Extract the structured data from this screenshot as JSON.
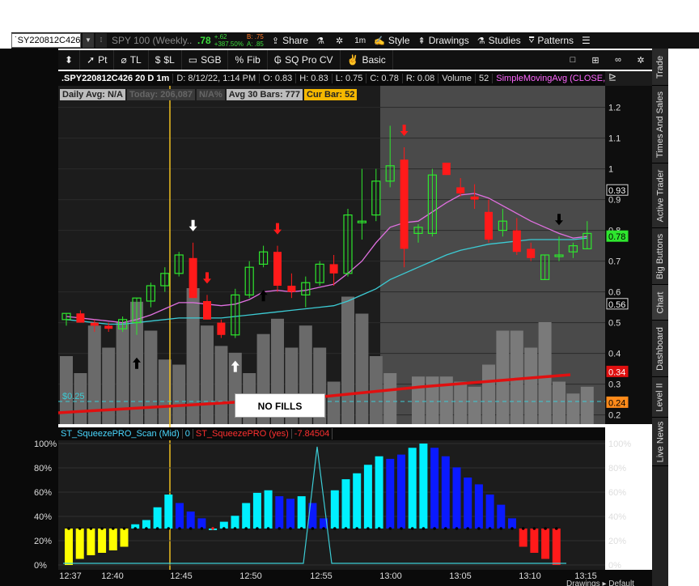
{
  "topbar": {
    "symbol": "˙SY220812C426",
    "underlying": "SPY 100 (Weekly...",
    "last": ".78",
    "change_abs": "+.62",
    "change_pct": "+387.50%",
    "bid": "B: .75",
    "ask": "A: .85",
    "share": "Share",
    "timeframe": "1m",
    "style": "Style",
    "drawings": "Drawings",
    "studies": "Studies",
    "patterns": "Patterns"
  },
  "toolbar2": {
    "pt": "Pt",
    "tl": "TL",
    "sl": "$L",
    "sgb": "SGB",
    "fib": "Fib",
    "sqpro": "SQ Pro CV",
    "basic": "Basic"
  },
  "chart_info": {
    "symbol": ".SPY220812C426 20 D 1m",
    "date": "D: 8/12/22, 1:14 PM",
    "open": "O: 0.83",
    "high": "H: 0.83",
    "low": "L: 0.75",
    "close": "C: 0.78",
    "range": "R: 0.08",
    "volume_label": "Volume",
    "volume": "52",
    "sma": "SimpleMovingAvg (CLOSE, 8,..."
  },
  "badges": {
    "daily_avg": "Daily Avg: N/A",
    "today": "Today: 206,087",
    "na_pct": "N/A%",
    "avg30": "Avg 30 Bars: 777",
    "cur_bar": "Cur Bar: 52"
  },
  "no_fills": "NO FILLS",
  "price_line_label": "$0.25",
  "study_header": {
    "name": "ST_SqueezePRO_Scan (Mid)",
    "value": "0",
    "name2": "ST_SqueezePRO (yes)",
    "value2": "-7.84504"
  },
  "side_tabs": [
    "Trade",
    "Times And Sales",
    "Active Trader",
    "Big Buttons",
    "Chart",
    "Dashboard",
    "Level II",
    "Live News"
  ],
  "active_side_tab": "Chart",
  "bottom_right": "Drawings  ▸  Default",
  "colors": {
    "up": "#2ee62e",
    "down": "#ff1a1a",
    "sma_fast": "#e070e0",
    "sma_slow": "#3ccbd4",
    "cyan_bar": "#00f0ff",
    "blue_bar": "#0a1aff",
    "yellow_bar": "#ffff00",
    "red_bar": "#ff1a1a",
    "volume": "#6a6a6a",
    "trend_line": "#e01010",
    "vline": "#f0c020"
  },
  "chart_data": [
    {
      "type": "candlestick",
      "x_ticks": [
        "12:37",
        "12:40",
        "12:45",
        "12:50",
        "12:55",
        "13:00",
        "13:05",
        "13:10",
        "13:15"
      ],
      "y_ticks": [
        "0.2",
        "0.3",
        "0.4",
        "0.5",
        "0.6",
        "0.7",
        "0.8",
        "0.9",
        "1",
        "1.1",
        "1.2"
      ],
      "ylim": [
        0.17,
        1.27
      ],
      "price_labels": [
        {
          "text": "0.93",
          "value": 0.93,
          "style": "box"
        },
        {
          "text": "0.78",
          "value": 0.78,
          "style": "green"
        },
        {
          "text": "0.56",
          "value": 0.56,
          "style": "box"
        },
        {
          "text": "0.34",
          "value": 0.34,
          "style": "red"
        },
        {
          "text": "0.24",
          "value": 0.24,
          "style": "orange"
        }
      ],
      "candles": [
        {
          "o": 0.51,
          "h": 0.53,
          "l": 0.49,
          "c": 0.53
        },
        {
          "o": 0.53,
          "h": 0.54,
          "l": 0.5,
          "c": 0.5
        },
        {
          "o": 0.5,
          "h": 0.51,
          "l": 0.47,
          "c": 0.49
        },
        {
          "o": 0.49,
          "h": 0.5,
          "l": 0.47,
          "c": 0.48
        },
        {
          "o": 0.48,
          "h": 0.52,
          "l": 0.47,
          "c": 0.51
        },
        {
          "o": 0.5,
          "h": 0.58,
          "l": 0.46,
          "c": 0.58
        },
        {
          "o": 0.57,
          "h": 0.63,
          "l": 0.55,
          "c": 0.62
        },
        {
          "o": 0.62,
          "h": 0.68,
          "l": 0.6,
          "c": 0.66
        },
        {
          "o": 0.66,
          "h": 0.73,
          "l": 0.65,
          "c": 0.72
        },
        {
          "o": 0.71,
          "h": 0.76,
          "l": 0.58,
          "c": 0.58
        },
        {
          "o": 0.57,
          "h": 0.59,
          "l": 0.51,
          "c": 0.51
        },
        {
          "o": 0.5,
          "h": 0.51,
          "l": 0.45,
          "c": 0.46
        },
        {
          "o": 0.46,
          "h": 0.61,
          "l": 0.45,
          "c": 0.59
        },
        {
          "o": 0.59,
          "h": 0.7,
          "l": 0.58,
          "c": 0.68
        },
        {
          "o": 0.69,
          "h": 0.75,
          "l": 0.68,
          "c": 0.73
        },
        {
          "o": 0.73,
          "h": 0.75,
          "l": 0.6,
          "c": 0.62
        },
        {
          "o": 0.62,
          "h": 0.66,
          "l": 0.58,
          "c": 0.6
        },
        {
          "o": 0.59,
          "h": 0.65,
          "l": 0.55,
          "c": 0.63
        },
        {
          "o": 0.63,
          "h": 0.7,
          "l": 0.62,
          "c": 0.69
        },
        {
          "o": 0.69,
          "h": 0.72,
          "l": 0.62,
          "c": 0.66
        },
        {
          "o": 0.66,
          "h": 0.87,
          "l": 0.65,
          "c": 0.85
        },
        {
          "o": 0.83,
          "h": 1.0,
          "l": 0.77,
          "c": 0.83
        },
        {
          "o": 0.85,
          "h": 1.0,
          "l": 0.83,
          "c": 0.96
        },
        {
          "o": 0.96,
          "h": 1.14,
          "l": 0.94,
          "c": 1.01
        },
        {
          "o": 1.03,
          "h": 1.07,
          "l": 0.68,
          "c": 0.74
        },
        {
          "o": 0.79,
          "h": 0.82,
          "l": 0.76,
          "c": 0.81
        },
        {
          "o": 0.79,
          "h": 1.0,
          "l": 0.78,
          "c": 0.98
        },
        {
          "o": 1.02,
          "h": 1.02,
          "l": 0.98,
          "c": 0.98
        },
        {
          "o": 0.94,
          "h": 0.97,
          "l": 0.91,
          "c": 0.92
        },
        {
          "o": 0.91,
          "h": 0.95,
          "l": 0.87,
          "c": 0.9
        },
        {
          "o": 0.86,
          "h": 0.9,
          "l": 0.76,
          "c": 0.77
        },
        {
          "o": 0.8,
          "h": 0.87,
          "l": 0.78,
          "c": 0.83
        },
        {
          "o": 0.8,
          "h": 0.84,
          "l": 0.72,
          "c": 0.73
        },
        {
          "o": 0.74,
          "h": 0.76,
          "l": 0.7,
          "c": 0.71
        },
        {
          "o": 0.64,
          "h": 0.72,
          "l": 0.64,
          "c": 0.72
        },
        {
          "o": 0.72,
          "h": 0.78,
          "l": 0.7,
          "c": 0.72
        },
        {
          "o": 0.73,
          "h": 0.76,
          "l": 0.71,
          "c": 0.75
        },
        {
          "o": 0.74,
          "h": 0.83,
          "l": 0.74,
          "c": 0.79
        }
      ],
      "sma_fast": [
        0.52,
        0.515,
        0.51,
        0.505,
        0.5,
        0.51,
        0.525,
        0.545,
        0.565,
        0.565,
        0.56,
        0.555,
        0.56,
        0.575,
        0.6,
        0.605,
        0.6,
        0.605,
        0.615,
        0.625,
        0.66,
        0.7,
        0.76,
        0.81,
        0.825,
        0.83,
        0.86,
        0.89,
        0.915,
        0.92,
        0.905,
        0.88,
        0.855,
        0.83,
        0.81,
        0.79,
        0.775,
        0.78
      ],
      "sma_slow": [
        0.51,
        0.505,
        0.5,
        0.495,
        0.495,
        0.5,
        0.505,
        0.51,
        0.515,
        0.515,
        0.515,
        0.515,
        0.52,
        0.525,
        0.53,
        0.535,
        0.54,
        0.545,
        0.55,
        0.555,
        0.57,
        0.59,
        0.61,
        0.64,
        0.66,
        0.68,
        0.7,
        0.72,
        0.735,
        0.745,
        0.755,
        0.76,
        0.765,
        0.77,
        0.77,
        0.77,
        0.77,
        0.775
      ],
      "volume": [
        40,
        30,
        58,
        45,
        60,
        72,
        55,
        38,
        35,
        80,
        58,
        46,
        42,
        30,
        53,
        62,
        45,
        58,
        45,
        25,
        75,
        65,
        40,
        30,
        0,
        28,
        28,
        28,
        25,
        22,
        35,
        55,
        55,
        45,
        60,
        25,
        18,
        22
      ],
      "arrows": [
        {
          "i": 5,
          "dir": "up",
          "color": "#000"
        },
        {
          "i": 9,
          "dir": "down",
          "color": "#fff"
        },
        {
          "i": 10,
          "dir": "down",
          "color": "#ff1a1a"
        },
        {
          "i": 12,
          "dir": "up",
          "color": "#fff"
        },
        {
          "i": 14,
          "dir": "up",
          "color": "#000"
        },
        {
          "i": 15,
          "dir": "down",
          "color": "#ff1a1a"
        },
        {
          "i": 24,
          "dir": "down",
          "color": "#ff1a1a"
        },
        {
          "i": 35,
          "dir": "down",
          "color": "#000"
        }
      ]
    },
    {
      "type": "bar",
      "y_ticks": [
        "0%",
        "20%",
        "40%",
        "60%",
        "80%",
        "100%"
      ],
      "ylim": [
        0,
        100
      ],
      "values": [
        -30,
        -25,
        -22,
        -20,
        -18,
        -15,
        5,
        10,
        25,
        40,
        30,
        20,
        12,
        0,
        8,
        15,
        30,
        42,
        45,
        38,
        35,
        38,
        30,
        12,
        45,
        58,
        65,
        75,
        85,
        82,
        87,
        95,
        100,
        95,
        85,
        72,
        60,
        52,
        40,
        28,
        12,
        -15,
        -20,
        -25,
        -30
      ],
      "colors": [
        "y",
        "y",
        "y",
        "y",
        "y",
        "y",
        "c",
        "c",
        "c",
        "c",
        "b",
        "b",
        "b",
        "c",
        "c",
        "c",
        "c",
        "c",
        "c",
        "b",
        "b",
        "c",
        "b",
        "b",
        "c",
        "c",
        "c",
        "c",
        "c",
        "b",
        "b",
        "c",
        "c",
        "b",
        "b",
        "b",
        "b",
        "b",
        "b",
        "b",
        "b",
        "r",
        "r",
        "r",
        "r"
      ]
    }
  ]
}
